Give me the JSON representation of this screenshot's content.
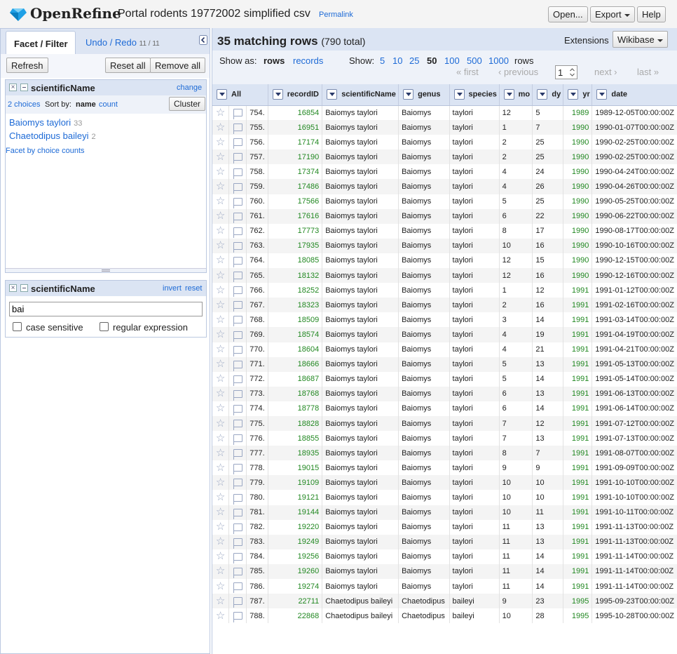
{
  "app": {
    "logo": "OpenRefine",
    "project_name": "Portal rodents 19772002 simplified csv",
    "permalink": "Permalink",
    "menu": {
      "open": "Open...",
      "export": "Export",
      "help": "Help"
    }
  },
  "left": {
    "tabs": {
      "facet": "Facet / Filter",
      "undo": "Undo / Redo",
      "undo_count": "11 / 11"
    },
    "refresh": "Refresh",
    "reset_all": "Reset all",
    "remove_all": "Remove all",
    "facet1": {
      "name": "scientificName",
      "change": "change",
      "choices": "2 choices",
      "sort_by": "Sort by:",
      "sort_name": "name",
      "sort_count": "count",
      "cluster": "Cluster",
      "items": [
        {
          "label": "Baiomys taylori",
          "count": "33"
        },
        {
          "label": "Chaetodipus baileyi",
          "count": "2"
        }
      ],
      "facet_by_counts": "Facet by choice counts"
    },
    "facet2": {
      "name": "scientificName",
      "invert": "invert",
      "reset": "reset",
      "filter_value": "bai",
      "case_sensitive": "case sensitive",
      "regular_expression": "regular expression"
    }
  },
  "right": {
    "matching": "35 matching rows",
    "total": "(790 total)",
    "extensions_label": "Extensions",
    "wikibase": "Wikibase",
    "show_as": "Show as:",
    "rows_mode": "rows",
    "records_mode": "records",
    "show": "Show:",
    "page_sizes": [
      "5",
      "10",
      "25",
      "50",
      "100",
      "500",
      "1000"
    ],
    "rows_suffix": "rows",
    "page_input": "1",
    "pager": {
      "first": "« first",
      "prev": "‹ previous",
      "next": "next ›",
      "last": "last »"
    },
    "columns": [
      "All",
      "recordID",
      "scientificName",
      "genus",
      "species",
      "mo",
      "dy",
      "yr",
      "date"
    ],
    "rows": [
      [
        "754.",
        "16854",
        "Baiomys taylori",
        "Baiomys",
        "taylori",
        "12",
        "5",
        "1989",
        "1989-12-05T00:00:00Z"
      ],
      [
        "755.",
        "16951",
        "Baiomys taylori",
        "Baiomys",
        "taylori",
        "1",
        "7",
        "1990",
        "1990-01-07T00:00:00Z"
      ],
      [
        "756.",
        "17174",
        "Baiomys taylori",
        "Baiomys",
        "taylori",
        "2",
        "25",
        "1990",
        "1990-02-25T00:00:00Z"
      ],
      [
        "757.",
        "17190",
        "Baiomys taylori",
        "Baiomys",
        "taylori",
        "2",
        "25",
        "1990",
        "1990-02-25T00:00:00Z"
      ],
      [
        "758.",
        "17374",
        "Baiomys taylori",
        "Baiomys",
        "taylori",
        "4",
        "24",
        "1990",
        "1990-04-24T00:00:00Z"
      ],
      [
        "759.",
        "17486",
        "Baiomys taylori",
        "Baiomys",
        "taylori",
        "4",
        "26",
        "1990",
        "1990-04-26T00:00:00Z"
      ],
      [
        "760.",
        "17566",
        "Baiomys taylori",
        "Baiomys",
        "taylori",
        "5",
        "25",
        "1990",
        "1990-05-25T00:00:00Z"
      ],
      [
        "761.",
        "17616",
        "Baiomys taylori",
        "Baiomys",
        "taylori",
        "6",
        "22",
        "1990",
        "1990-06-22T00:00:00Z"
      ],
      [
        "762.",
        "17773",
        "Baiomys taylori",
        "Baiomys",
        "taylori",
        "8",
        "17",
        "1990",
        "1990-08-17T00:00:00Z"
      ],
      [
        "763.",
        "17935",
        "Baiomys taylori",
        "Baiomys",
        "taylori",
        "10",
        "16",
        "1990",
        "1990-10-16T00:00:00Z"
      ],
      [
        "764.",
        "18085",
        "Baiomys taylori",
        "Baiomys",
        "taylori",
        "12",
        "15",
        "1990",
        "1990-12-15T00:00:00Z"
      ],
      [
        "765.",
        "18132",
        "Baiomys taylori",
        "Baiomys",
        "taylori",
        "12",
        "16",
        "1990",
        "1990-12-16T00:00:00Z"
      ],
      [
        "766.",
        "18252",
        "Baiomys taylori",
        "Baiomys",
        "taylori",
        "1",
        "12",
        "1991",
        "1991-01-12T00:00:00Z"
      ],
      [
        "767.",
        "18323",
        "Baiomys taylori",
        "Baiomys",
        "taylori",
        "2",
        "16",
        "1991",
        "1991-02-16T00:00:00Z"
      ],
      [
        "768.",
        "18509",
        "Baiomys taylori",
        "Baiomys",
        "taylori",
        "3",
        "14",
        "1991",
        "1991-03-14T00:00:00Z"
      ],
      [
        "769.",
        "18574",
        "Baiomys taylori",
        "Baiomys",
        "taylori",
        "4",
        "19",
        "1991",
        "1991-04-19T00:00:00Z"
      ],
      [
        "770.",
        "18604",
        "Baiomys taylori",
        "Baiomys",
        "taylori",
        "4",
        "21",
        "1991",
        "1991-04-21T00:00:00Z"
      ],
      [
        "771.",
        "18666",
        "Baiomys taylori",
        "Baiomys",
        "taylori",
        "5",
        "13",
        "1991",
        "1991-05-13T00:00:00Z"
      ],
      [
        "772.",
        "18687",
        "Baiomys taylori",
        "Baiomys",
        "taylori",
        "5",
        "14",
        "1991",
        "1991-05-14T00:00:00Z"
      ],
      [
        "773.",
        "18768",
        "Baiomys taylori",
        "Baiomys",
        "taylori",
        "6",
        "13",
        "1991",
        "1991-06-13T00:00:00Z"
      ],
      [
        "774.",
        "18778",
        "Baiomys taylori",
        "Baiomys",
        "taylori",
        "6",
        "14",
        "1991",
        "1991-06-14T00:00:00Z"
      ],
      [
        "775.",
        "18828",
        "Baiomys taylori",
        "Baiomys",
        "taylori",
        "7",
        "12",
        "1991",
        "1991-07-12T00:00:00Z"
      ],
      [
        "776.",
        "18855",
        "Baiomys taylori",
        "Baiomys",
        "taylori",
        "7",
        "13",
        "1991",
        "1991-07-13T00:00:00Z"
      ],
      [
        "777.",
        "18935",
        "Baiomys taylori",
        "Baiomys",
        "taylori",
        "8",
        "7",
        "1991",
        "1991-08-07T00:00:00Z"
      ],
      [
        "778.",
        "19015",
        "Baiomys taylori",
        "Baiomys",
        "taylori",
        "9",
        "9",
        "1991",
        "1991-09-09T00:00:00Z"
      ],
      [
        "779.",
        "19109",
        "Baiomys taylori",
        "Baiomys",
        "taylori",
        "10",
        "10",
        "1991",
        "1991-10-10T00:00:00Z"
      ],
      [
        "780.",
        "19121",
        "Baiomys taylori",
        "Baiomys",
        "taylori",
        "10",
        "10",
        "1991",
        "1991-10-10T00:00:00Z"
      ],
      [
        "781.",
        "19144",
        "Baiomys taylori",
        "Baiomys",
        "taylori",
        "10",
        "11",
        "1991",
        "1991-10-11T00:00:00Z"
      ],
      [
        "782.",
        "19220",
        "Baiomys taylori",
        "Baiomys",
        "taylori",
        "11",
        "13",
        "1991",
        "1991-11-13T00:00:00Z"
      ],
      [
        "783.",
        "19249",
        "Baiomys taylori",
        "Baiomys",
        "taylori",
        "11",
        "13",
        "1991",
        "1991-11-13T00:00:00Z"
      ],
      [
        "784.",
        "19256",
        "Baiomys taylori",
        "Baiomys",
        "taylori",
        "11",
        "14",
        "1991",
        "1991-11-14T00:00:00Z"
      ],
      [
        "785.",
        "19260",
        "Baiomys taylori",
        "Baiomys",
        "taylori",
        "11",
        "14",
        "1991",
        "1991-11-14T00:00:00Z"
      ],
      [
        "786.",
        "19274",
        "Baiomys taylori",
        "Baiomys",
        "taylori",
        "11",
        "14",
        "1991",
        "1991-11-14T00:00:00Z"
      ],
      [
        "787.",
        "22711",
        "Chaetodipus baileyi",
        "Chaetodipus",
        "baileyi",
        "9",
        "23",
        "1995",
        "1995-09-23T00:00:00Z"
      ],
      [
        "788.",
        "22868",
        "Chaetodipus baileyi",
        "Chaetodipus",
        "baileyi",
        "10",
        "28",
        "1995",
        "1995-10-28T00:00:00Z"
      ]
    ]
  },
  "colors": {
    "link": "#1d6ad6",
    "numeric": "#228822",
    "header_bg": "#dbe4f3"
  }
}
